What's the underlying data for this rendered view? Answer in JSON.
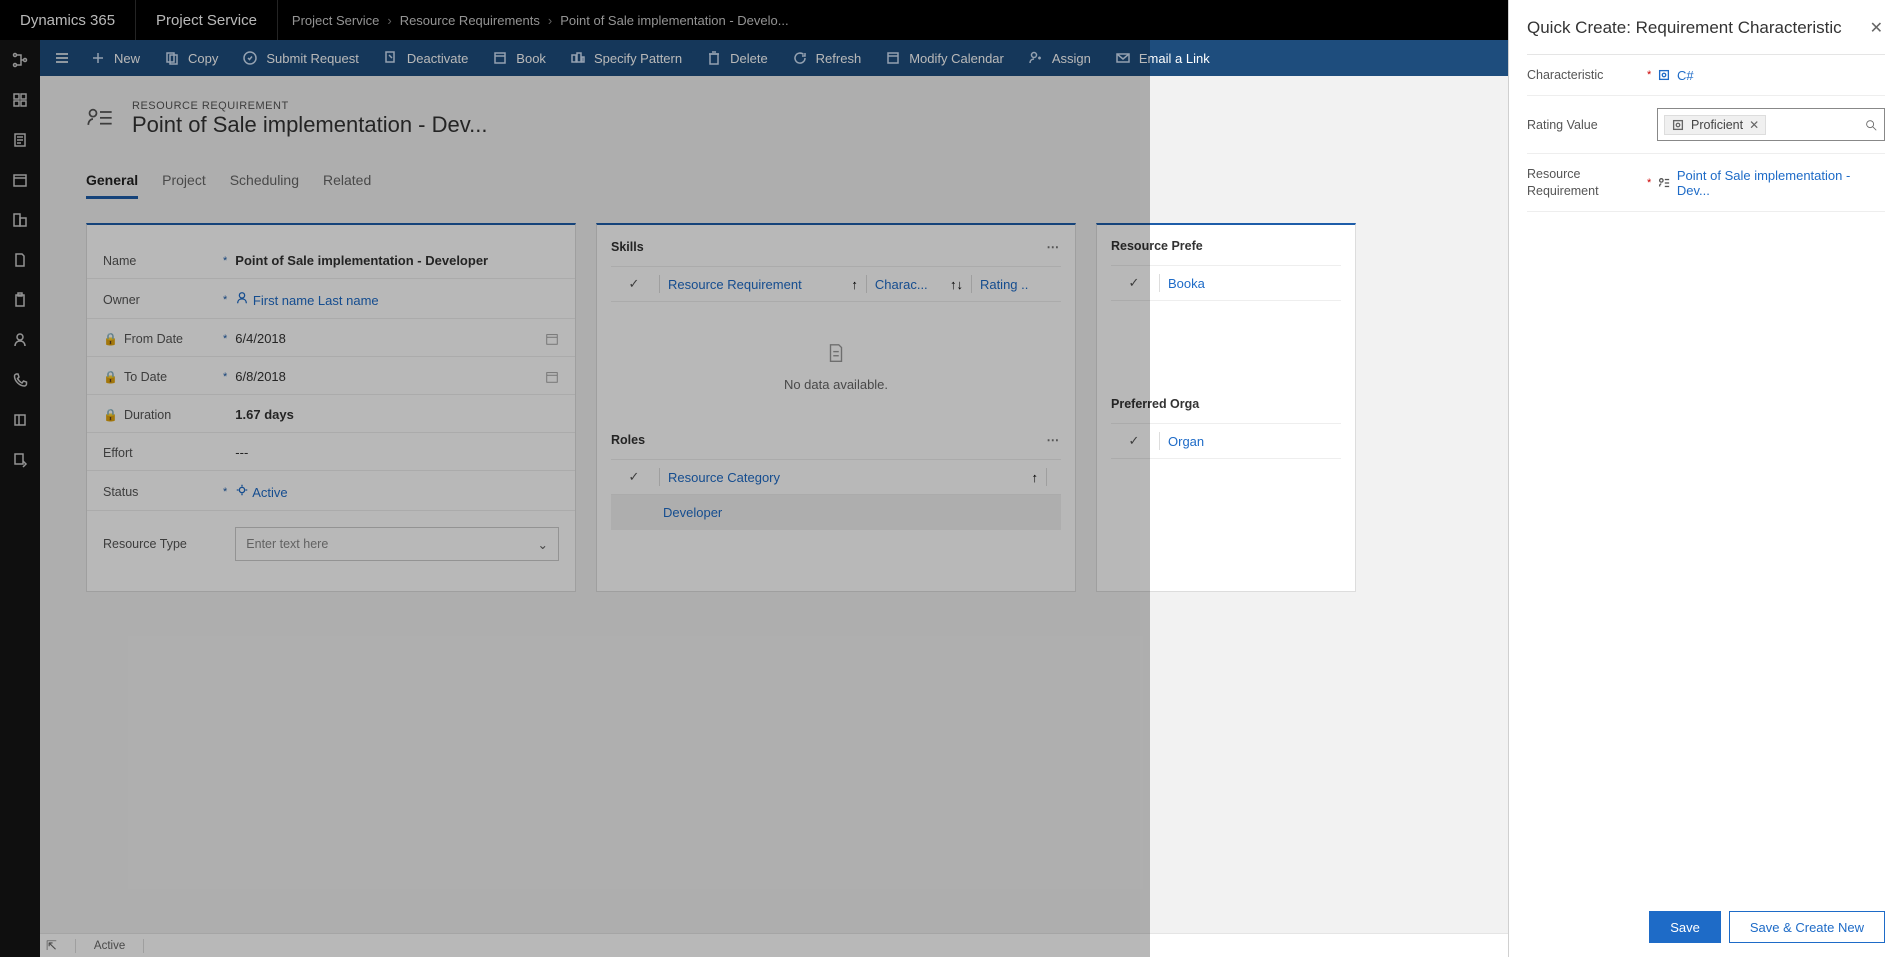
{
  "topbar": {
    "brand": "Dynamics 365",
    "app": "Project Service",
    "breadcrumb1": "Project Service",
    "breadcrumb2": "Resource Requirements",
    "breadcrumb3": "Point of Sale implementation - Develo..."
  },
  "commands": {
    "new": "New",
    "copy": "Copy",
    "submit_request": "Submit Request",
    "deactivate": "Deactivate",
    "book": "Book",
    "specify_pattern": "Specify Pattern",
    "delete": "Delete",
    "refresh": "Refresh",
    "modify_calendar": "Modify Calendar",
    "assign": "Assign",
    "email_link": "Email a Link"
  },
  "record": {
    "entity": "RESOURCE REQUIREMENT",
    "title": "Point of Sale implementation - Dev..."
  },
  "tabs": {
    "general": "General",
    "project": "Project",
    "scheduling": "Scheduling",
    "related": "Related"
  },
  "fields": {
    "name_label": "Name",
    "name_value": "Point of Sale implementation - Developer",
    "owner_label": "Owner",
    "owner_value": "First name Last name",
    "from_label": "From Date",
    "from_value": "6/4/2018",
    "to_label": "To Date",
    "to_value": "6/8/2018",
    "duration_label": "Duration",
    "duration_value": "1.67 days",
    "effort_label": "Effort",
    "effort_value": "---",
    "status_label": "Status",
    "status_value": "Active",
    "restype_label": "Resource Type",
    "restype_placeholder": "Enter text here"
  },
  "skills": {
    "title": "Skills",
    "col_rr": "Resource Requirement",
    "col_char": "Charac...",
    "col_rating": "Rating ..",
    "no_data": "No data available."
  },
  "roles": {
    "title": "Roles",
    "col_rc": "Resource Category",
    "row1": "Developer"
  },
  "panel_right": {
    "title_pref": "Resource Prefe",
    "col_book": "Booka",
    "title_org": "Preferred Orga",
    "col_org": "Organ"
  },
  "status": {
    "text": "Active"
  },
  "qc": {
    "title": "Quick Create: Requirement Characteristic",
    "char_label": "Characteristic",
    "char_value": "C#",
    "rating_label": "Rating Value",
    "rating_tag": "Proficient",
    "rr_label": "Resource Requirement",
    "rr_value": "Point of Sale implementation - Dev...",
    "save": "Save",
    "save_new": "Save & Create New"
  }
}
